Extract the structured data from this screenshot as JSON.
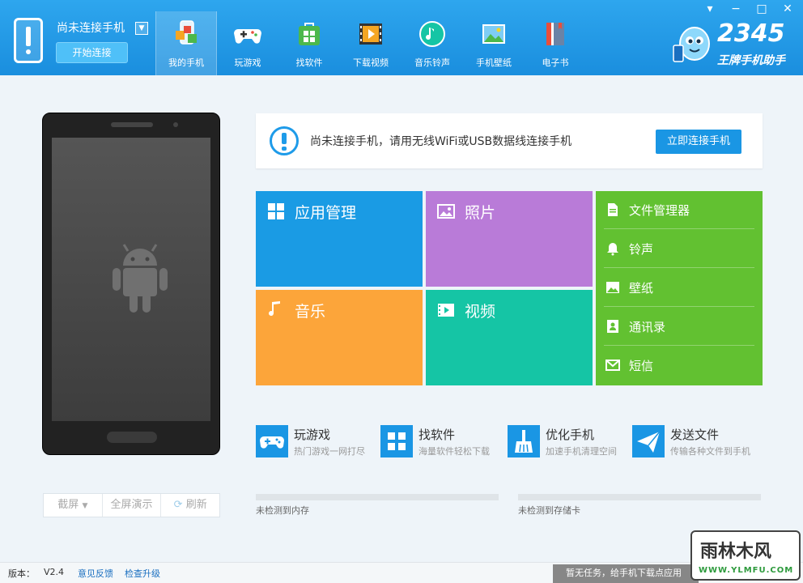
{
  "header": {
    "connection_title": "尚未连接手机",
    "start_button": "开始连接",
    "nav": [
      {
        "label": "我的手机",
        "icon": "my-phone-icon"
      },
      {
        "label": "玩游戏",
        "icon": "gamepad-icon"
      },
      {
        "label": "找软件",
        "icon": "app-store-icon"
      },
      {
        "label": "下载视频",
        "icon": "video-download-icon"
      },
      {
        "label": "音乐铃声",
        "icon": "music-ringtone-icon"
      },
      {
        "label": "手机壁纸",
        "icon": "wallpaper-icon"
      },
      {
        "label": "电子书",
        "icon": "ebook-icon"
      }
    ],
    "brand_number": "2345",
    "brand_name": "王牌手机助手"
  },
  "notice": {
    "text": "尚未连接手机，请用无线WiFi或USB数据线连接手机",
    "button": "立即连接手机"
  },
  "tiles": {
    "apps": "应用管理",
    "photos": "照片",
    "music": "音乐",
    "video": "视频"
  },
  "side_menu": [
    {
      "label": "文件管理器",
      "icon": "file-icon"
    },
    {
      "label": "铃声",
      "icon": "bell-icon"
    },
    {
      "label": "壁纸",
      "icon": "image-icon"
    },
    {
      "label": "通讯录",
      "icon": "contacts-icon"
    },
    {
      "label": "短信",
      "icon": "mail-icon"
    }
  ],
  "quick_actions": [
    {
      "title": "玩游戏",
      "desc": "热门游戏一网打尽",
      "icon": "gamepad-icon"
    },
    {
      "title": "找软件",
      "desc": "海量软件轻松下载",
      "icon": "apps-grid-icon"
    },
    {
      "title": "优化手机",
      "desc": "加速手机清理空间",
      "icon": "broom-icon"
    },
    {
      "title": "发送文件",
      "desc": "传输各种文件到手机",
      "icon": "send-icon"
    }
  ],
  "storage": {
    "memory_label": "未检测到内存",
    "storage_label": "未检测到存储卡"
  },
  "phone_tools": {
    "screenshot": "截屏",
    "fullscreen": "全屏演示",
    "refresh": "刷新"
  },
  "footer": {
    "version_label": "版本：",
    "version": "V2.4",
    "feedback": "意见反馈",
    "update": "检查升级",
    "task_status": "暂无任务，给手机下载点应用"
  },
  "watermark": {
    "name": "雨林木风",
    "url": "WWW.YLMFU.COM"
  }
}
